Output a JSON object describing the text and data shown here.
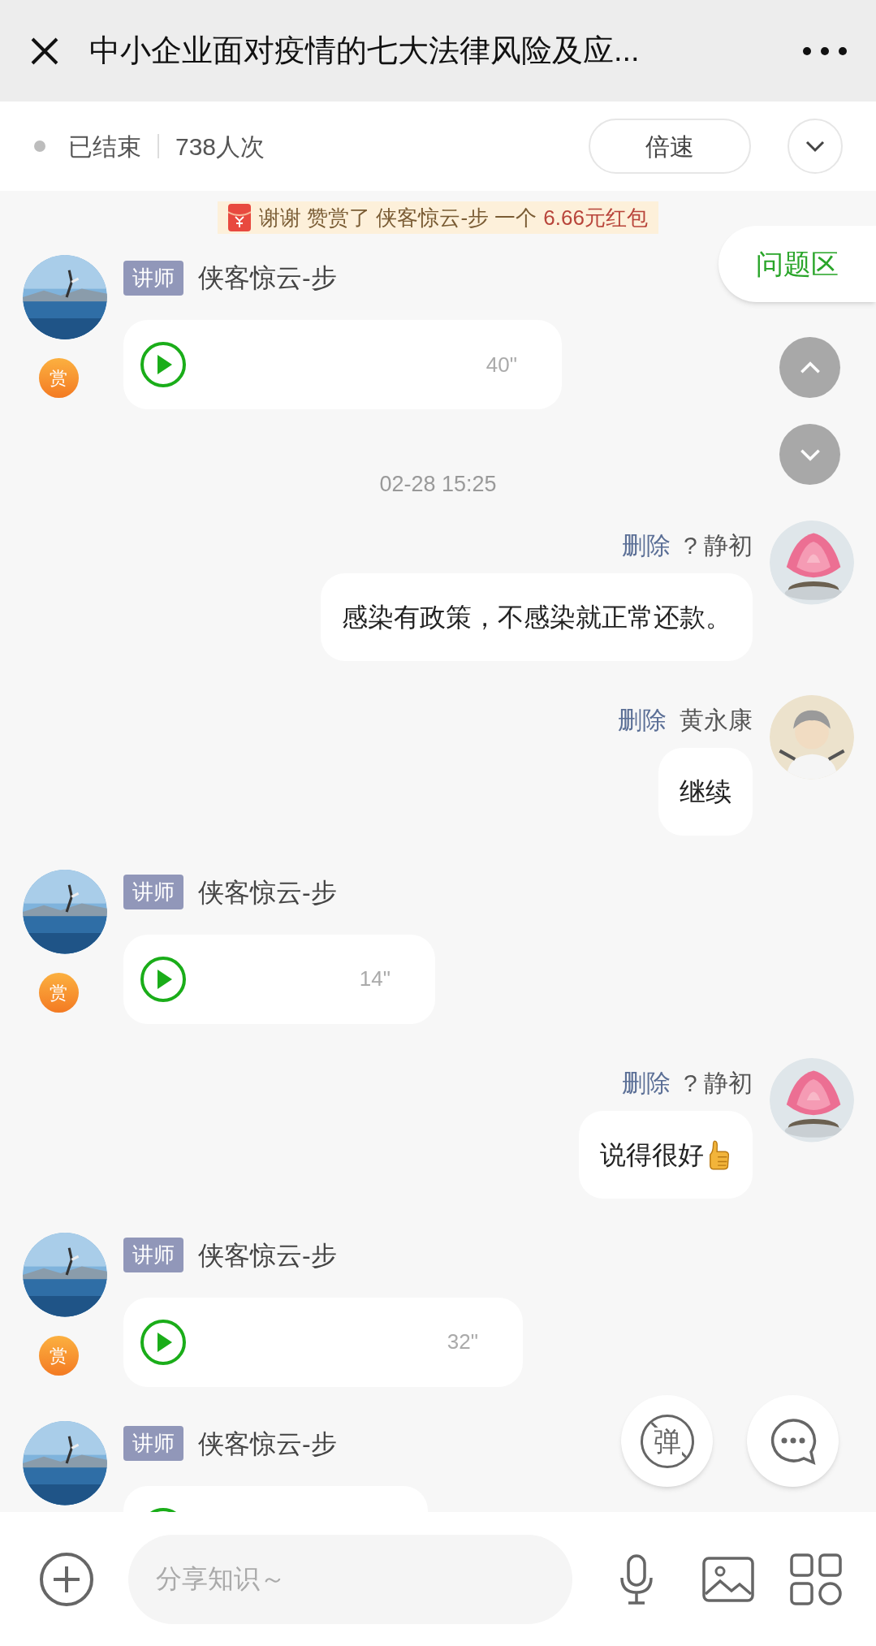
{
  "header": {
    "title": "中小企业面对疫情的七大法律风险及应..."
  },
  "status": {
    "state": "已结束",
    "count": "738人次",
    "speed_button": "倍速"
  },
  "reward_notice": {
    "text": "谢谢 赞赏了 侠客惊云-步 一个",
    "amount": "6.66元红包"
  },
  "question_tab": "问题区",
  "messages": [
    {
      "kind": "voice",
      "role_tag": "讲师",
      "name": "侠客惊云-步",
      "duration": "40\"",
      "reward_badge": "赏"
    },
    {
      "kind": "time",
      "text": "02-28 15:25"
    },
    {
      "kind": "text",
      "delete": "删除",
      "name": "? 静初",
      "text": "感染有政策，不感染就正常还款。"
    },
    {
      "kind": "text",
      "delete": "删除",
      "name": "黄永康",
      "text": "继续"
    },
    {
      "kind": "voice",
      "role_tag": "讲师",
      "name": "侠客惊云-步",
      "duration": "14\"",
      "reward_badge": "赏"
    },
    {
      "kind": "text",
      "delete": "删除",
      "name": "? 静初",
      "text": "说得很好",
      "thumbs_up": true
    },
    {
      "kind": "voice",
      "role_tag": "讲师",
      "name": "侠客惊云-步",
      "duration": "32\"",
      "reward_badge": "赏"
    },
    {
      "kind": "voice",
      "role_tag": "讲师",
      "name": "侠客惊云-步"
    }
  ],
  "danmaku_button": "弹",
  "composer": {
    "placeholder": "分享知识～"
  }
}
